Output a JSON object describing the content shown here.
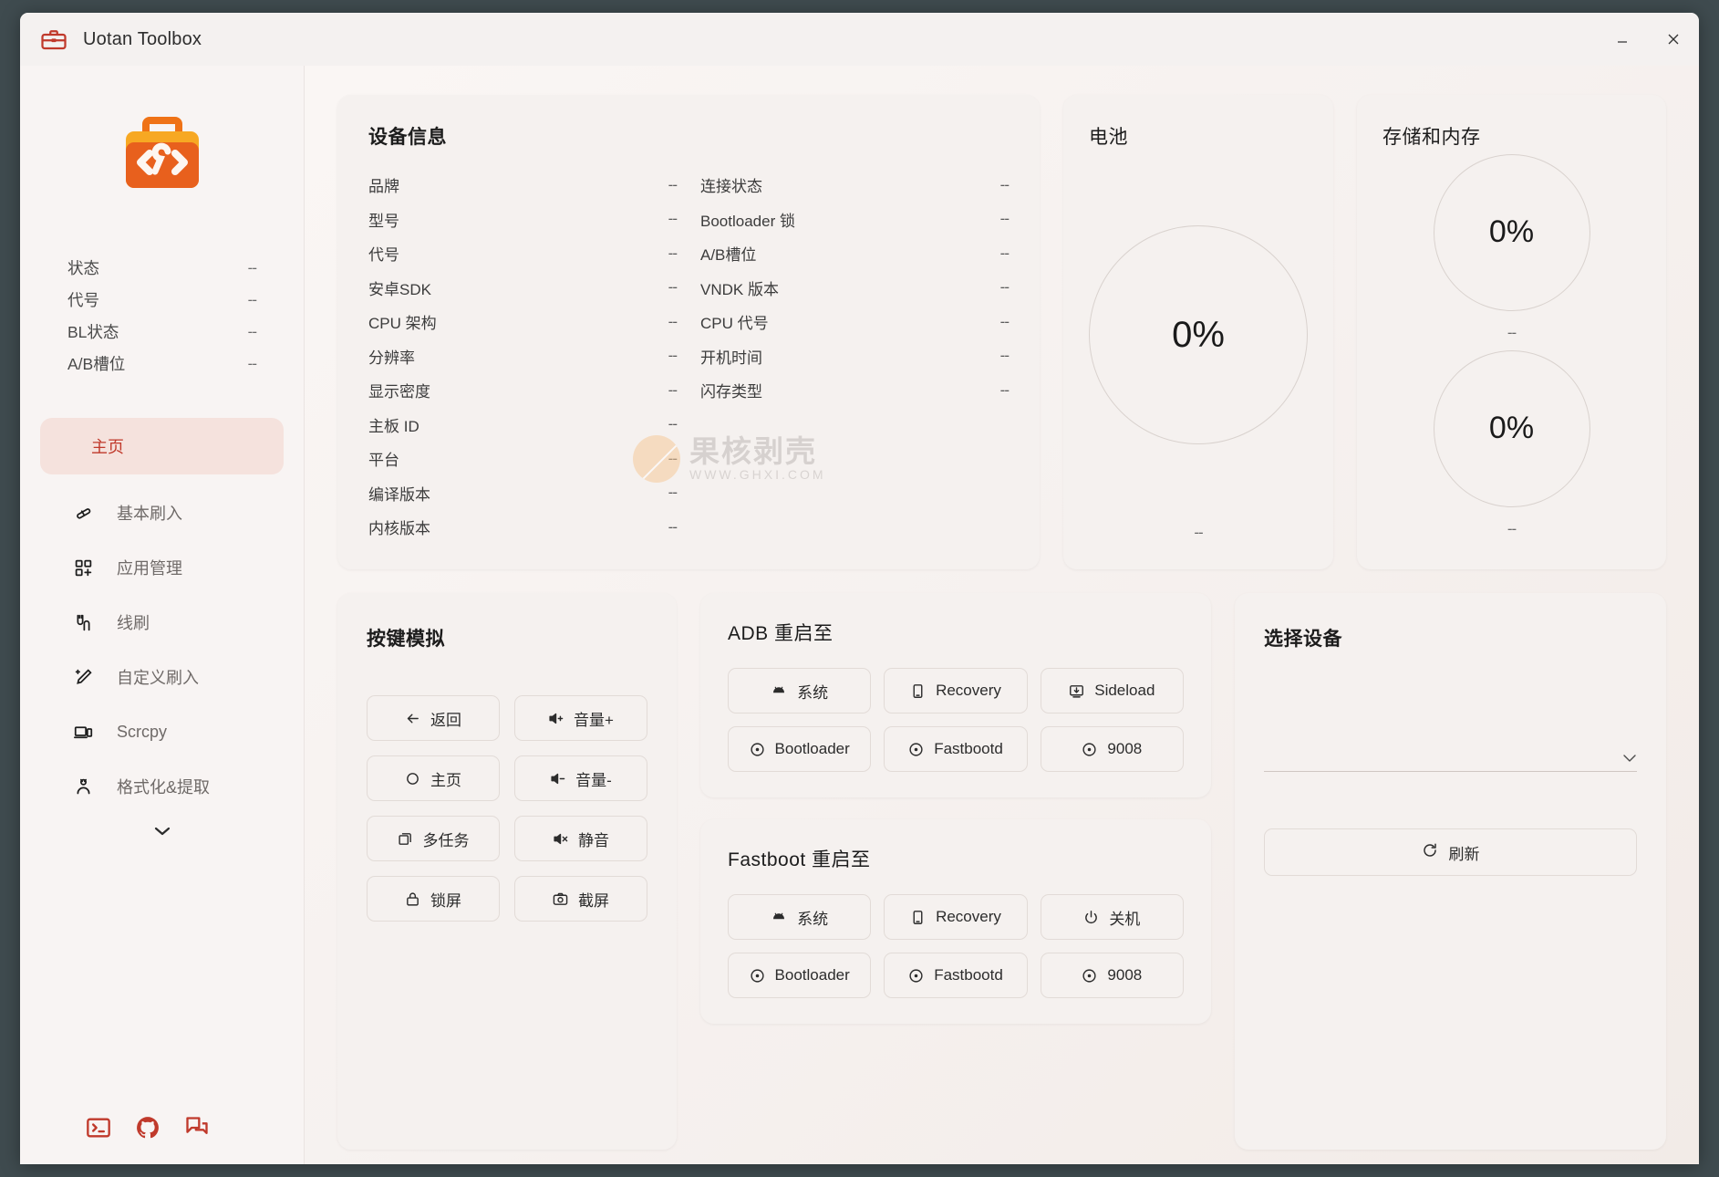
{
  "window": {
    "title": "Uotan Toolbox",
    "app_icon": "toolbox-icon",
    "minimize_label": "—",
    "close_label": "✕"
  },
  "sidebar": {
    "logo_icon": "toolbox-logo-icon",
    "status": [
      {
        "label": "状态",
        "value": "--"
      },
      {
        "label": "代号",
        "value": "--"
      },
      {
        "label": "BL状态",
        "value": "--"
      },
      {
        "label": "A/B槽位",
        "value": "--"
      }
    ],
    "nav": [
      {
        "label": "主页",
        "icon": "home-icon",
        "active": true
      },
      {
        "label": "基本刷入",
        "icon": "flash-icon",
        "active": false
      },
      {
        "label": "应用管理",
        "icon": "apps-icon",
        "active": false
      },
      {
        "label": "线刷",
        "icon": "cable-icon",
        "active": false
      },
      {
        "label": "自定义刷入",
        "icon": "magic-pen-icon",
        "active": false
      },
      {
        "label": "Scrcpy",
        "icon": "screen-mirror-icon",
        "active": false
      },
      {
        "label": "格式化&提取",
        "icon": "extract-icon",
        "active": false
      }
    ],
    "expand_icon": "chevron-down-icon",
    "bottom_icons": [
      {
        "name": "terminal-icon"
      },
      {
        "name": "github-icon"
      },
      {
        "name": "forum-icon"
      }
    ],
    "accent": "#c0392b"
  },
  "device_info": {
    "title": "设备信息",
    "left": [
      {
        "label": "品牌",
        "value": "--"
      },
      {
        "label": "型号",
        "value": "--"
      },
      {
        "label": "代号",
        "value": "--"
      },
      {
        "label": "安卓SDK",
        "value": "--"
      },
      {
        "label": "CPU 架构",
        "value": "--"
      },
      {
        "label": "分辨率",
        "value": "--"
      },
      {
        "label": "显示密度",
        "value": "--"
      },
      {
        "label": "主板 ID",
        "value": "--"
      },
      {
        "label": "平台",
        "value": "--"
      },
      {
        "label": "编译版本",
        "value": "--"
      },
      {
        "label": "内核版本",
        "value": "--"
      }
    ],
    "right": [
      {
        "label": "连接状态",
        "value": "--"
      },
      {
        "label": "Bootloader 锁",
        "value": "--"
      },
      {
        "label": "A/B槽位",
        "value": "--"
      },
      {
        "label": "VNDK 版本",
        "value": "--"
      },
      {
        "label": "CPU 代号",
        "value": "--"
      },
      {
        "label": "开机时间",
        "value": "--"
      },
      {
        "label": "闪存类型",
        "value": "--"
      }
    ]
  },
  "battery": {
    "title": "电池",
    "percent": "0%",
    "detail": "--"
  },
  "storage": {
    "title": "存储和内存",
    "items": [
      {
        "percent": "0%",
        "detail": "--"
      },
      {
        "percent": "0%",
        "detail": "--"
      }
    ]
  },
  "key_sim": {
    "title": "按键模拟",
    "buttons": [
      {
        "label": "返回",
        "icon": "arrow-left-icon"
      },
      {
        "label": "音量+",
        "icon": "volume-up-icon"
      },
      {
        "label": "主页",
        "icon": "circle-icon"
      },
      {
        "label": "音量-",
        "icon": "volume-down-icon"
      },
      {
        "label": "多任务",
        "icon": "multitask-icon"
      },
      {
        "label": "静音",
        "icon": "mute-icon"
      },
      {
        "label": "锁屏",
        "icon": "lock-icon"
      },
      {
        "label": "截屏",
        "icon": "camera-icon"
      }
    ]
  },
  "adb_reboot": {
    "title": "ADB 重启至",
    "buttons": [
      {
        "label": "系统",
        "icon": "android-icon"
      },
      {
        "label": "Recovery",
        "icon": "phone-icon"
      },
      {
        "label": "Sideload",
        "icon": "sideload-icon"
      },
      {
        "label": "Bootloader",
        "icon": "target-icon"
      },
      {
        "label": "Fastbootd",
        "icon": "target-icon"
      },
      {
        "label": "9008",
        "icon": "target-icon"
      }
    ]
  },
  "fastboot_reboot": {
    "title": "Fastboot 重启至",
    "buttons": [
      {
        "label": "系统",
        "icon": "android-icon"
      },
      {
        "label": "Recovery",
        "icon": "phone-icon"
      },
      {
        "label": "关机",
        "icon": "power-icon"
      },
      {
        "label": "Bootloader",
        "icon": "target-icon"
      },
      {
        "label": "Fastbootd",
        "icon": "target-icon"
      },
      {
        "label": "9008",
        "icon": "target-icon"
      }
    ]
  },
  "device_select": {
    "title": "选择设备",
    "dropdown_value": "",
    "dropdown_icon": "chevron-down-icon",
    "refresh_label": "刷新",
    "refresh_icon": "refresh-icon"
  },
  "watermark": {
    "text_cn": "果核剥壳",
    "text_url": "WWW.GHXI.COM"
  }
}
